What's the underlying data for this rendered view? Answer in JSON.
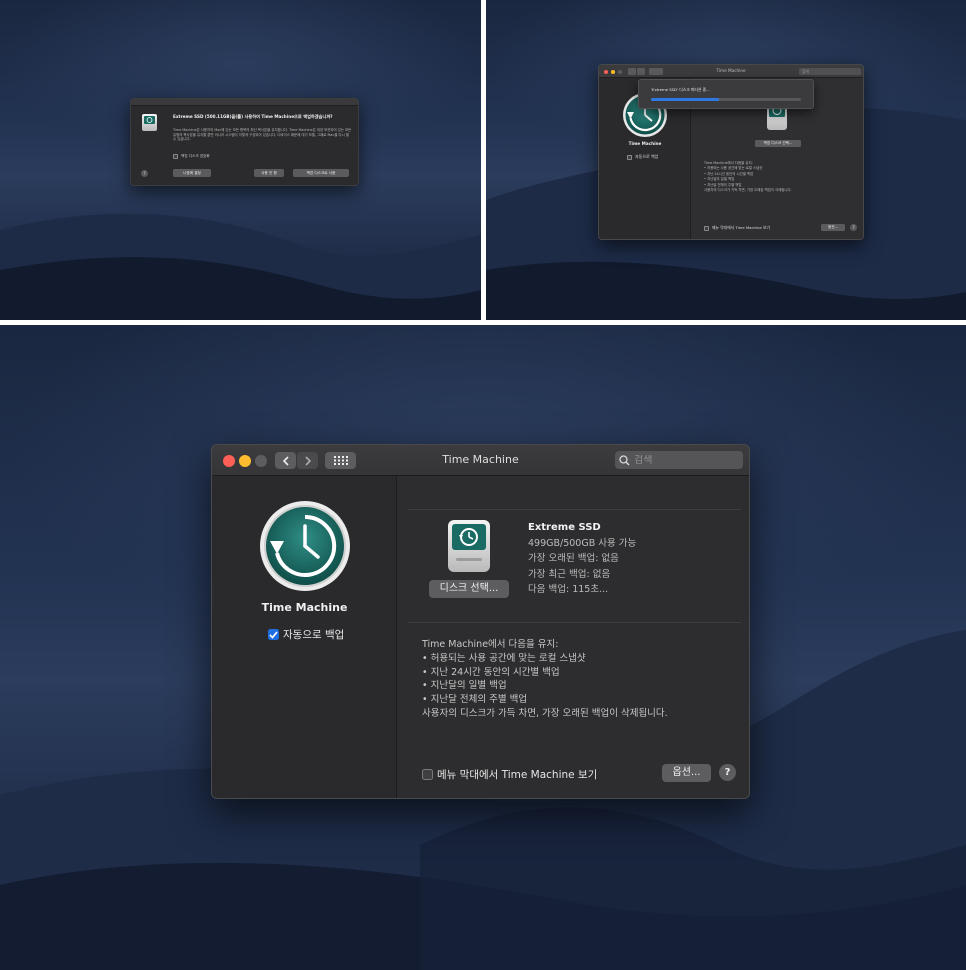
{
  "dialog": {
    "title": "Extreme SSD (500.11GB)을(를) 사용하여 Time Machine으로 백업하겠습니까?",
    "body": "Time Machine은 사용자의 Mac에 있는 모든 항목의 최신 복사본을 유지합니다. Time Machine은 외장 보관되어 있는 모든 유형의 복사본을 유지할 뿐만 아니라 시스템이 이렇게 구성되어 있습니다. 디바이스 때문에 대기 모델, 그때로 Mac을 다시 할 수 있습니다.",
    "checkbox_label": "백업 디스크 암호화",
    "button_decide_later": "나중에 결정",
    "button_dont_use": "사용 안 함",
    "button_use_backup_disk": "백업 디스크로 사용",
    "help": "?"
  },
  "mini_window": {
    "title": "Time Machine",
    "search_placeholder": "검색",
    "progress_text": "'Extreme SSD' 디스크 파티션 중...",
    "progress_fraction": 0.45,
    "app_label": "Time Machine",
    "auto_backup_label": "자동으로 백업",
    "select_disk_button": "백업 디스크 선택...",
    "info_lines": [
      "Time Machine에서 다음을 유지:",
      "• 허용되는 사용 공간에 맞는 로컬 스냅샷",
      "• 지난 24시간 동안의 시간별 백업",
      "• 지난달의 일별 백업",
      "• 지난달 전체의 주별 백업",
      "사용자의 디스크가 가득 차면, 가장 오래된 백업이 삭제됩니다."
    ],
    "menubar_checkbox_label": "메뉴 막대에서 Time Machine 보기",
    "options_button": "옵션...",
    "help": "?"
  },
  "window": {
    "title": "Time Machine",
    "search_placeholder": "검색",
    "sidebar": {
      "app_label": "Time Machine",
      "auto_backup_label": "자동으로 백업",
      "auto_backup_checked": true
    },
    "disk": {
      "name": "Extreme SSD",
      "capacity": "499GB/500GB 사용 가능",
      "oldest_backup": "가장 오래된 백업: 없음",
      "latest_backup": "가장 최근 백업: 없음",
      "next_backup": "다음 백업: 115초...",
      "select_button": "디스크 선택..."
    },
    "keep": {
      "heading": "Time Machine에서 다음을 유지:",
      "items": [
        "허용되는 사용 공간에 맞는 로컬 스냅샷",
        "지난 24시간 동안의 시간별 백업",
        "지난달의 일별 백업",
        "지난달 전체의 주별 백업"
      ],
      "footer": "사용자의 디스크가 가득 차면, 가장 오래된 백업이 삭제됩니다."
    },
    "menubar_checkbox_label": "메뉴 막대에서 Time Machine 보기",
    "menubar_checked": false,
    "options_button": "옵션...",
    "help": "?"
  },
  "colors": {
    "close": "#fe5f57",
    "minimize": "#febc2e",
    "accent": "#1f6fe0",
    "teal": "#1b6b65"
  }
}
